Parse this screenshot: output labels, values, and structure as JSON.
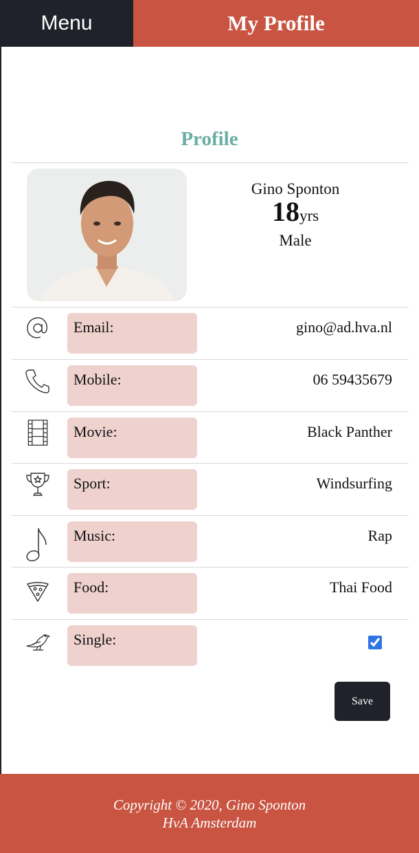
{
  "header": {
    "menu_label": "Menu",
    "title": "My Profile"
  },
  "section": {
    "title": "Profile"
  },
  "profile": {
    "name": "Gino Sponton",
    "age": "18",
    "age_unit": "yrs",
    "gender": "Male"
  },
  "fields": [
    {
      "icon": "at-sign-icon",
      "label": "Email:",
      "value": "gino@ad.hva.nl"
    },
    {
      "icon": "phone-icon",
      "label": "Mobile:",
      "value": "06 59435679"
    },
    {
      "icon": "film-strip-icon",
      "label": "Movie:",
      "value": "Black Panther"
    },
    {
      "icon": "trophy-icon",
      "label": "Sport:",
      "value": "Windsurfing"
    },
    {
      "icon": "music-note-icon",
      "label": "Music:",
      "value": "Rap"
    },
    {
      "icon": "pizza-slice-icon",
      "label": "Food:",
      "value": "Thai Food"
    },
    {
      "icon": "bird-icon",
      "label": "Single:",
      "checked": true
    }
  ],
  "actions": {
    "save_label": "Save"
  },
  "footer": {
    "copyright": "Copyright © 2020, Gino Sponton",
    "org": "HvA Amsterdam"
  },
  "colors": {
    "dark": "#1f222b",
    "accent": "#c85441",
    "section_title": "#6aaea3",
    "label_bg": "#efd2ce",
    "checkbox": "#2f74e4"
  }
}
